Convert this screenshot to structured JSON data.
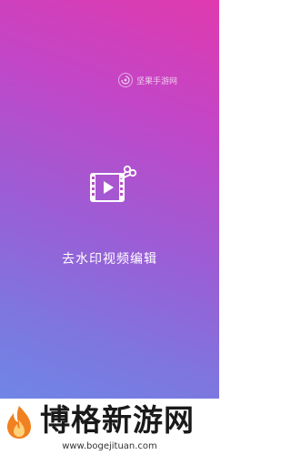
{
  "watermark": {
    "text": "坚果手游网",
    "icon": "brand-badge-icon"
  },
  "app": {
    "title": "去水印视频编辑",
    "icon": "video-scissors-icon"
  },
  "footer": {
    "brand_name": "博格新游网",
    "url": "www.bogejituan.com",
    "logo": "flame-logo"
  },
  "colors": {
    "gradient_top": "#e03aae",
    "gradient_mid": "#9a5ed6",
    "gradient_bottom": "#6f86e6",
    "text": "#ffffff",
    "logo_orange": "#f08020"
  }
}
